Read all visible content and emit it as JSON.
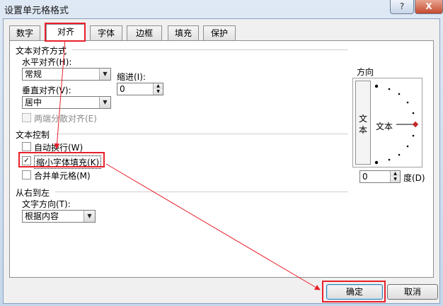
{
  "window": {
    "title": "设置单元格格式",
    "help_label": "?",
    "close_label": "X"
  },
  "tabs": [
    {
      "label": "数字"
    },
    {
      "label": "对齐",
      "active": true
    },
    {
      "label": "字体"
    },
    {
      "label": "边框"
    },
    {
      "label": "填充"
    },
    {
      "label": "保护"
    }
  ],
  "text_alignment": {
    "section_label": "文本对齐方式",
    "horizontal_label": "水平对齐(H):",
    "horizontal_value": "常规",
    "indent_label": "缩进(I):",
    "indent_value": "0",
    "vertical_label": "垂直对齐(V):",
    "vertical_value": "居中",
    "justify_distributed_label": "两端分散对齐(E)",
    "justify_distributed_checked": false
  },
  "text_control": {
    "section_label": "文本控制",
    "wrap_text_label": "自动换行(W)",
    "wrap_text_checked": false,
    "shrink_to_fit_label": "缩小字体填充(K)",
    "shrink_to_fit_checked": true,
    "merge_cells_label": "合并单元格(M)",
    "merge_cells_checked": false,
    "check_mark": "✓"
  },
  "rtl": {
    "section_label": "从右到左",
    "direction_label": "文字方向(T):",
    "direction_value": "根据内容"
  },
  "orientation": {
    "section_label": "方向",
    "vertical_char_1": "文",
    "vertical_char_2": "本",
    "dial_text": "文本",
    "degrees_value": "0",
    "degrees_label": "度(D)"
  },
  "buttons": {
    "ok_label": "确定",
    "cancel_label": "取消"
  },
  "colors": {
    "annotation_red": "#e8202a",
    "dial_marker": "#c0282a"
  }
}
